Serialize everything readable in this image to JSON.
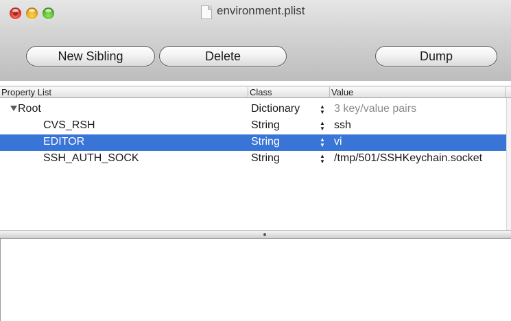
{
  "window": {
    "title": "environment.plist"
  },
  "toolbar": {
    "new_sibling_label": "New Sibling",
    "delete_label": "Delete",
    "dump_label": "Dump"
  },
  "table": {
    "headers": {
      "property": "Property List",
      "class": "Class",
      "value": "Value"
    },
    "rows": [
      {
        "property": "Root",
        "class": "Dictionary",
        "value": "3 key/value pairs"
      },
      {
        "property": "CVS_RSH",
        "class": "String",
        "value": "ssh"
      },
      {
        "property": "EDITOR",
        "class": "String",
        "value": "vi"
      },
      {
        "property": "SSH_AUTH_SOCK",
        "class": "String",
        "value": "/tmp/501/SSHKeychain.socket"
      }
    ],
    "selected_row": "EDITOR"
  },
  "colors": {
    "selection": "#3875d7",
    "close": "#e0443a",
    "minimize": "#f5b822",
    "zoom": "#5cc43a"
  },
  "icons": {
    "traffic_lights": [
      "close-button",
      "minimize-button",
      "zoom-button"
    ],
    "title": "document-icon",
    "row_stepper": "stepper-arrows-icon",
    "disclosure": "disclosure-triangle-down-icon"
  }
}
